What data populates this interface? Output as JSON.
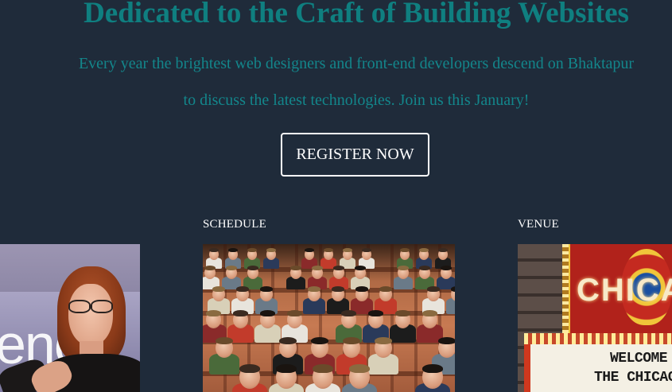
{
  "hero": {
    "title": "Dedicated to the Craft of Building Websites",
    "description": "Every year the brightest web designers and front-end developers descend on Bhaktapur to discuss the latest technologies. Join us this January!",
    "register_label": "REGISTER NOW"
  },
  "sections": {
    "schedule": {
      "label": "SCHEDULE"
    },
    "venue": {
      "label": "VENUE",
      "sign_text": "CHICAGO",
      "marquee_line1": "WELCOME TO",
      "marquee_line2": "THE CHICAGO THEATRE"
    }
  },
  "colors": {
    "background": "#1f2b3a",
    "accent_teal": "#0f7f80",
    "button_border": "#ffffff"
  }
}
